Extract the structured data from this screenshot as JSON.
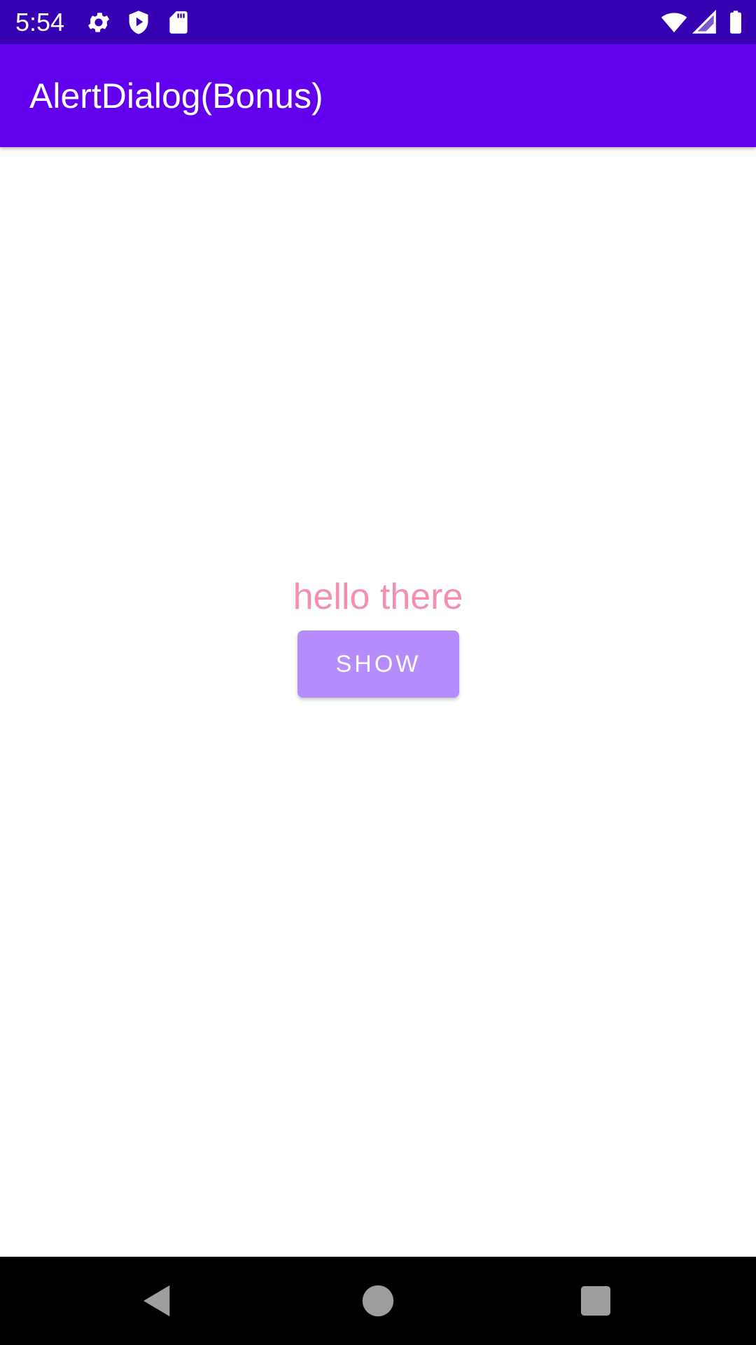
{
  "status_bar": {
    "time": "5:54",
    "icons": [
      "settings-icon",
      "play-protect-icon",
      "sd-card-icon",
      "wifi-icon",
      "cellular-signal-icon",
      "battery-icon"
    ],
    "background_color": "#3700b3"
  },
  "app_bar": {
    "title": "AlertDialog(Bonus)",
    "background_color": "#6200ee"
  },
  "main": {
    "message": "hello there",
    "message_color": "#f48fb1",
    "show_button_label": "SHOW",
    "button_color": "#b68bfb"
  },
  "nav_bar": {
    "icons": [
      "back-icon",
      "home-icon",
      "recents-icon"
    ]
  }
}
